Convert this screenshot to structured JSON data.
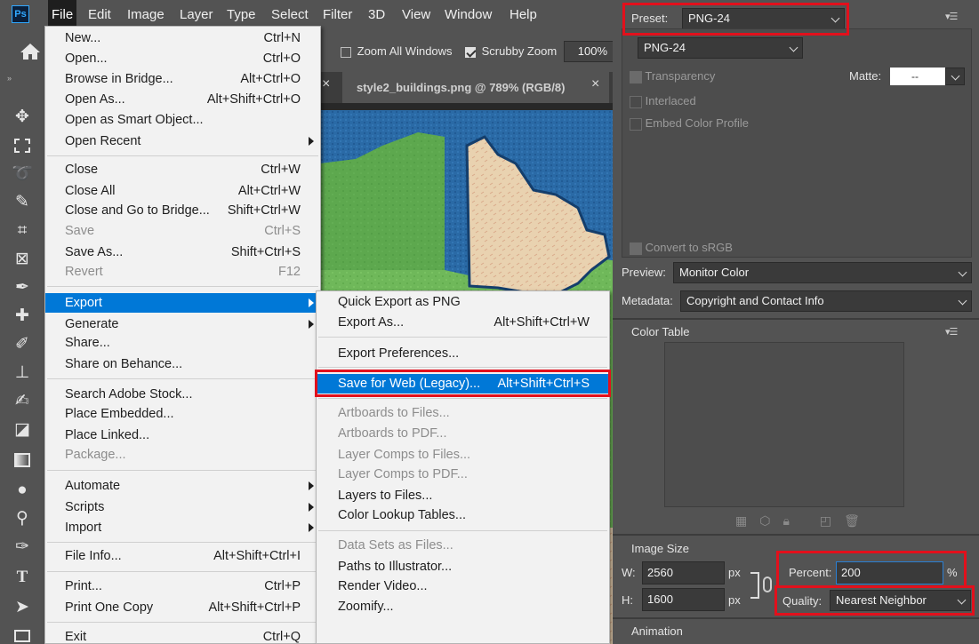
{
  "menubar": {
    "logo": "Ps",
    "items": [
      "File",
      "Edit",
      "Image",
      "Layer",
      "Type",
      "Select",
      "Filter",
      "3D",
      "View",
      "Window",
      "Help"
    ]
  },
  "options": {
    "zoom_all_windows": "Zoom All Windows",
    "scrubby_zoom": "Scrubby Zoom",
    "zoom_value": "100%"
  },
  "document_tab": {
    "title": "style2_buildings.png @ 789% (RGB/8)",
    "close_glyph": "×"
  },
  "file_menu": {
    "items": [
      {
        "label": "New...",
        "shortcut": "Ctrl+N"
      },
      {
        "label": "Open...",
        "shortcut": "Ctrl+O"
      },
      {
        "label": "Browse in Bridge...",
        "shortcut": "Alt+Ctrl+O"
      },
      {
        "label": "Open As...",
        "shortcut": "Alt+Shift+Ctrl+O"
      },
      {
        "label": "Open as Smart Object...",
        "shortcut": ""
      },
      {
        "label": "Open Recent",
        "shortcut": ""
      },
      {
        "label": "Close",
        "shortcut": "Ctrl+W"
      },
      {
        "label": "Close All",
        "shortcut": "Alt+Ctrl+W"
      },
      {
        "label": "Close and Go to Bridge...",
        "shortcut": "Shift+Ctrl+W"
      },
      {
        "label": "Save",
        "shortcut": "Ctrl+S"
      },
      {
        "label": "Save As...",
        "shortcut": "Shift+Ctrl+S"
      },
      {
        "label": "Revert",
        "shortcut": "F12"
      },
      {
        "label": "Export",
        "shortcut": ""
      },
      {
        "label": "Generate",
        "shortcut": ""
      },
      {
        "label": "Share...",
        "shortcut": ""
      },
      {
        "label": "Share on Behance...",
        "shortcut": ""
      },
      {
        "label": "Search Adobe Stock...",
        "shortcut": ""
      },
      {
        "label": "Place Embedded...",
        "shortcut": ""
      },
      {
        "label": "Place Linked...",
        "shortcut": ""
      },
      {
        "label": "Package...",
        "shortcut": ""
      },
      {
        "label": "Automate",
        "shortcut": ""
      },
      {
        "label": "Scripts",
        "shortcut": ""
      },
      {
        "label": "Import",
        "shortcut": ""
      },
      {
        "label": "File Info...",
        "shortcut": "Alt+Shift+Ctrl+I"
      },
      {
        "label": "Print...",
        "shortcut": "Ctrl+P"
      },
      {
        "label": "Print One Copy",
        "shortcut": "Alt+Shift+Ctrl+P"
      },
      {
        "label": "Exit",
        "shortcut": "Ctrl+Q"
      }
    ]
  },
  "export_menu": {
    "items": [
      {
        "label": "Quick Export as PNG",
        "shortcut": ""
      },
      {
        "label": "Export As...",
        "shortcut": "Alt+Shift+Ctrl+W"
      },
      {
        "label": "Export Preferences...",
        "shortcut": ""
      },
      {
        "label": "Save for Web (Legacy)...",
        "shortcut": "Alt+Shift+Ctrl+S"
      },
      {
        "label": "Artboards to Files...",
        "shortcut": ""
      },
      {
        "label": "Artboards to PDF...",
        "shortcut": ""
      },
      {
        "label": "Layer Comps to Files...",
        "shortcut": ""
      },
      {
        "label": "Layer Comps to PDF...",
        "shortcut": ""
      },
      {
        "label": "Layers to Files...",
        "shortcut": ""
      },
      {
        "label": "Color Lookup Tables...",
        "shortcut": ""
      },
      {
        "label": "Data Sets as Files...",
        "shortcut": ""
      },
      {
        "label": "Paths to Illustrator...",
        "shortcut": ""
      },
      {
        "label": "Render Video...",
        "shortcut": ""
      },
      {
        "label": "Zoomify...",
        "shortcut": ""
      }
    ]
  },
  "save_for_web": {
    "preset_label": "Preset:",
    "preset_value": "PNG-24",
    "format_value": "PNG-24",
    "transparency": "Transparency",
    "matte_label": "Matte:",
    "matte_value": "--",
    "interlaced": "Interlaced",
    "embed_profile": "Embed Color Profile",
    "convert_srgb": "Convert to sRGB",
    "preview_label": "Preview:",
    "preview_value": "Monitor Color",
    "metadata_label": "Metadata:",
    "metadata_value": "Copyright and Contact Info",
    "color_table_title": "Color Table",
    "image_size_title": "Image Size",
    "w_label": "W:",
    "w_value": "2560",
    "h_label": "H:",
    "h_value": "1600",
    "px_unit": "px",
    "percent_label": "Percent:",
    "percent_value": "200",
    "percent_unit": "%",
    "quality_label": "Quality:",
    "quality_value": "Nearest Neighbor",
    "animation_title": "Animation"
  },
  "colors": {
    "highlight": "#0078d7",
    "annotation_red": "#e2101c",
    "water": "#2a6aa6",
    "grass": "#6fb85a",
    "sand": "#e9d2b0"
  }
}
